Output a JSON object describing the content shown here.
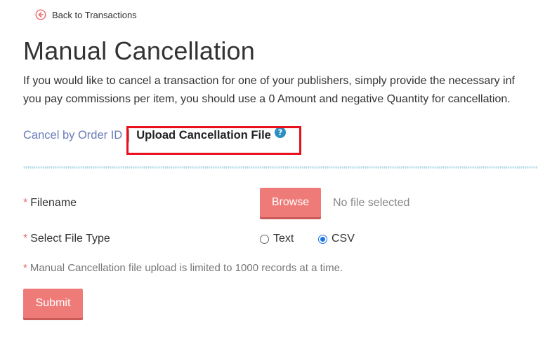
{
  "header": {
    "back_link_label": "Back to Transactions",
    "back_icon": "circle-arrow-left-icon"
  },
  "page": {
    "title": "Manual Cancellation",
    "description_line1": "If you would like to cancel a transaction for one of your publishers, simply provide the necessary inf",
    "description_line2": "you pay commissions per item, you should use a 0 Amount and negative Quantity for cancellation."
  },
  "tabs": {
    "items": [
      {
        "label": "Cancel by Order ID",
        "active": false
      },
      {
        "label": "Upload Cancellation File",
        "active": true
      }
    ],
    "help_icon": "question-circle-icon"
  },
  "form": {
    "filename": {
      "required_marker": "*",
      "label": "Filename",
      "browse_label": "Browse",
      "status": "No file selected"
    },
    "file_type": {
      "required_marker": "*",
      "label": "Select File Type",
      "options": [
        {
          "label": "Text",
          "checked": false
        },
        {
          "label": "CSV",
          "checked": true
        }
      ]
    },
    "note": {
      "required_marker": "*",
      "text": "Manual Cancellation file upload is limited to 1000 records at a time."
    },
    "submit_label": "Submit"
  },
  "colors": {
    "button_bg": "#ef7b79",
    "link": "#6b7cb8",
    "highlight_border": "#e8101c",
    "required": "#e8676a",
    "radio_checked": "#1a73e8",
    "help_icon": "#2b8fc0"
  }
}
